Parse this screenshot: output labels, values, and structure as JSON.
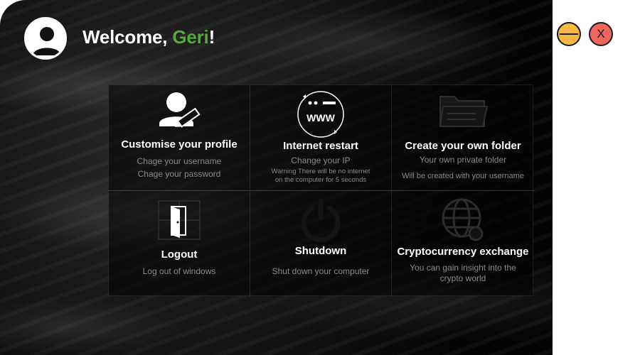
{
  "header": {
    "greeting_prefix": "Welcome, ",
    "user_name": "Geri",
    "greeting_suffix": "!",
    "name_color": "#5aa73e"
  },
  "window_controls": {
    "minimize_icon": "minimize-icon",
    "close_label": "X",
    "minimize_color": "#f6b743",
    "close_color": "#f0665f"
  },
  "tiles": [
    {
      "title": "Customise your profile",
      "lines": [
        "Chage your username",
        "Chage your password"
      ],
      "icon": "user-edit-icon"
    },
    {
      "title": "Internet restart",
      "lines": [
        "Change your IP"
      ],
      "warning": [
        "Warning There will be no internet",
        "on the computer for 5 seconds"
      ],
      "icon": "www-refresh-icon",
      "icon_text": "WWW"
    },
    {
      "title": "Create your own folder",
      "lines": [
        "Your own private folder",
        "Will be created with your username"
      ],
      "icon": "folder-icon"
    },
    {
      "title": "Logout",
      "lines": [
        "Log out of windows"
      ],
      "icon": "door-exit-icon"
    },
    {
      "title": "Shutdown",
      "lines": [
        "Shut down your computer"
      ],
      "icon": "power-icon"
    },
    {
      "title": "Cryptocurrency exchange",
      "lines": [
        "You can gain insight into the",
        "crypto world"
      ],
      "icon": "globe-crypto-icon"
    }
  ]
}
